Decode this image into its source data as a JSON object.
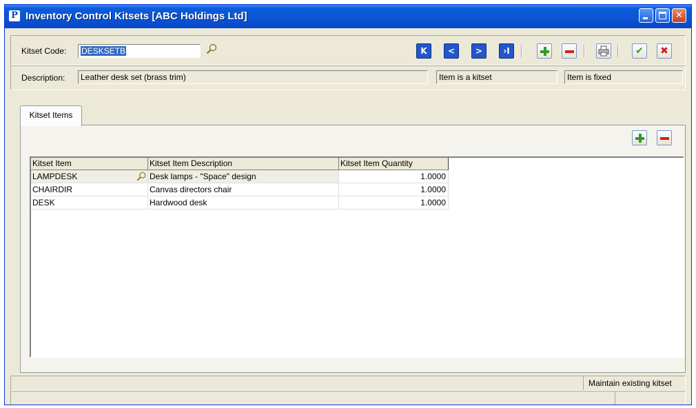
{
  "window": {
    "title": "Inventory Control Kitsets [ABC Holdings Ltd]",
    "app_icon_letter": "P"
  },
  "header": {
    "kitset_code_label": "Kitset Code:",
    "kitset_code_value": "DESKSETB",
    "description_label": "Description:",
    "description_value": "Leather desk set (brass trim)",
    "kitset_flag": "Item is a kitset",
    "fixed_flag": "Item is fixed"
  },
  "toolbar": {
    "first_glyph": "K",
    "prev_glyph": "<",
    "next_glyph": ">",
    "last_glyph": "›I",
    "ok_glyph": "✔",
    "cancel_glyph": "✖"
  },
  "tabs": [
    {
      "label": "Kitset Items"
    }
  ],
  "grid": {
    "columns": [
      "Kitset Item",
      "Kitset Item Description",
      "Kitset Item Quantity"
    ],
    "rows": [
      {
        "item": "LAMPDESK",
        "description": "Desk lamps - \"Space\" design",
        "quantity": "1.0000"
      },
      {
        "item": "CHAIRDIR",
        "description": "Canvas directors chair",
        "quantity": "1.0000"
      },
      {
        "item": "DESK",
        "description": "Hardwood desk",
        "quantity": "1.0000"
      }
    ]
  },
  "status": {
    "message": "Maintain existing kitset"
  },
  "colors": {
    "titlebar": "#0a54d3",
    "nav_button": "#2357c9",
    "add": "#2e9b2e",
    "remove": "#d21f1f",
    "selection": "#316ac5"
  }
}
